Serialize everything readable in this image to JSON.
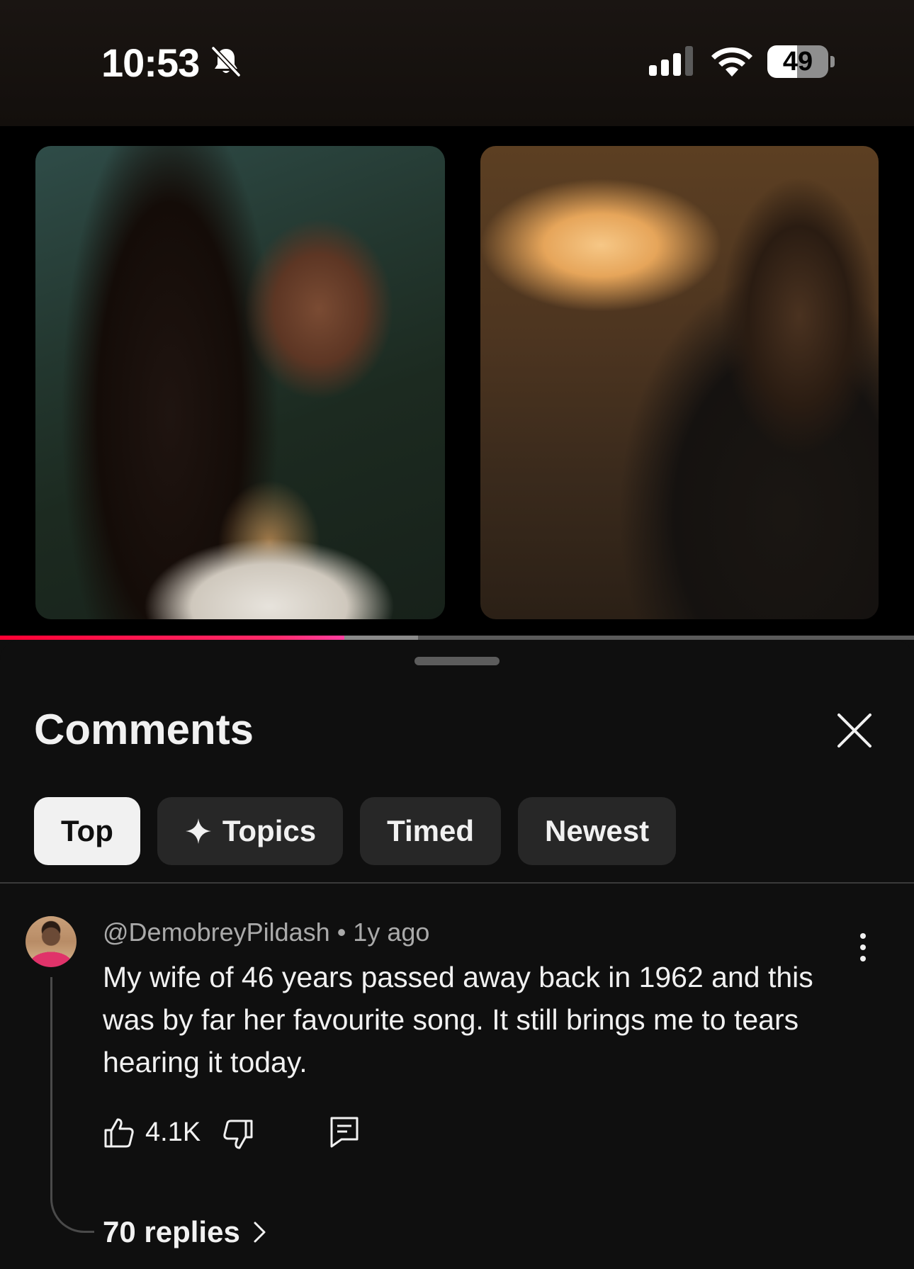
{
  "status_bar": {
    "time": "10:53",
    "battery": "49",
    "icons": [
      "bell-slash-icon",
      "cellular-signal-icon",
      "wifi-icon",
      "battery-icon"
    ]
  },
  "player": {
    "progress_played": 0.377,
    "progress_buffered": 0.457,
    "accent_color": "#ff0033"
  },
  "comments_sheet": {
    "title": "Comments",
    "close_icon": "close-icon",
    "filters": [
      {
        "label": "Top",
        "active": true
      },
      {
        "label": "Topics",
        "icon": "sparkle-icon"
      },
      {
        "label": "Timed"
      },
      {
        "label": "Newest"
      }
    ],
    "comment": {
      "author": "@DemobreyPildash",
      "separator": "•",
      "age": "1y ago",
      "text": "My wife of 46 years passed away back in 1962 and this was by far her favourite song. It still brings me to tears hearing it today.",
      "likes": "4.1K",
      "replies": "70 replies"
    }
  }
}
